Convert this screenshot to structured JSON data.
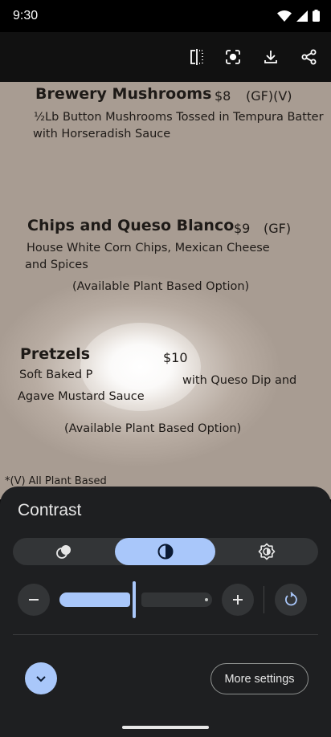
{
  "status_bar": {
    "time": "9:30"
  },
  "toolbar": {
    "icons": [
      "compare-icon",
      "lens-icon",
      "download-icon",
      "share-icon"
    ]
  },
  "photo": {
    "items": [
      {
        "name": "Brewery Mushrooms",
        "price": "$8",
        "tags": "(GF)(V)",
        "desc1": "½Lb Button Mushrooms Tossed in Tempura Batter",
        "desc2": "with Horseradish Sauce"
      },
      {
        "name": "Chips and Queso Blanco",
        "price": "$9",
        "tags": "(GF)",
        "desc1": "House White Corn Chips, Mexican Cheese",
        "desc2": "and Spices",
        "note": "(Available Plant Based Option)"
      },
      {
        "name": "Pretzels",
        "price": "$10",
        "desc1a": "Soft Baked P",
        "desc1b": "with Queso Dip and",
        "desc2": "Agave Mustard Sauce",
        "note": "(Available Plant Based Option)"
      }
    ],
    "footnote": "*(V) All Plant Based"
  },
  "sheet": {
    "title": "Contrast",
    "segments": [
      "color-icon",
      "contrast-icon",
      "brightness-icon"
    ],
    "active_segment": "contrast-icon",
    "slider_level_percent": 49,
    "more_settings_label": "More settings"
  },
  "colors": {
    "accent": "#a9c7fa",
    "sheet_bg": "#1e1f21",
    "control_bg": "#333537"
  }
}
